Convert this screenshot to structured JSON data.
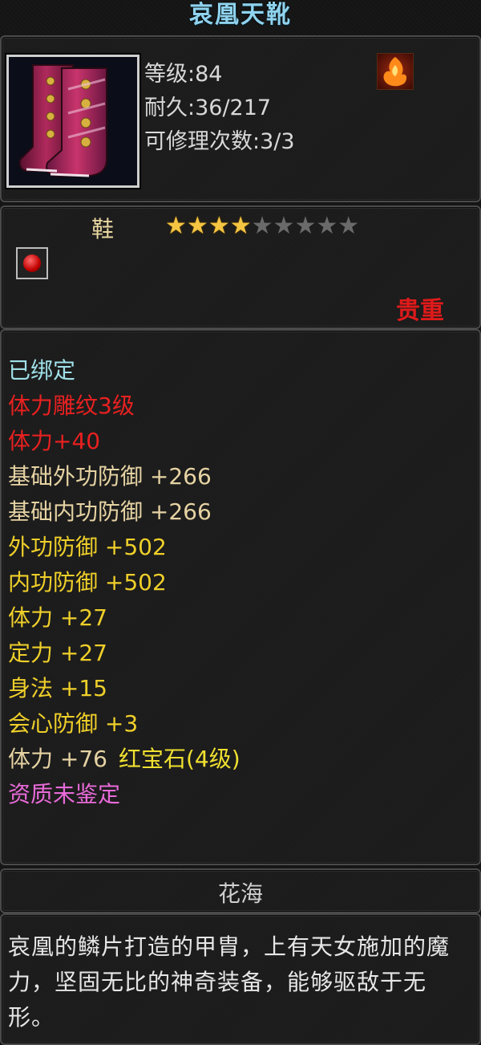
{
  "item": {
    "name": "哀凰天靴",
    "level": "等级:84",
    "durability": "耐久:36/217",
    "repair_count": "可修理次数:3/3",
    "icon": "purple-boots-icon",
    "school_icon": "flame-school-icon"
  },
  "type_section": {
    "item_type": "鞋",
    "stars_filled": 4,
    "stars_total": 9,
    "slot_icon": "red-gem-slot-icon",
    "rarity": "贵重",
    "rarity_color": "#e01a1a"
  },
  "attributes": {
    "bound": "已绑定",
    "engraving": "体力雕纹3级",
    "engraving_bonus": "体力+40",
    "base_outer_def": "基础外功防御 +266",
    "base_inner_def": "基础内功防御 +266",
    "outer_def": "外功防御 +502",
    "inner_def": "内功防御 +502",
    "stamina": "体力 +27",
    "focus": "定力 +27",
    "agility": "身法 +15",
    "crit_def": "会心防御 +3",
    "gem_bonus": "体力 +76",
    "gem_name": "红宝石(4级)",
    "aptitude": "资质未鉴定"
  },
  "set": {
    "name": "花海"
  },
  "description": {
    "text": "哀凰的鳞片打造的甲胄，上有天女施加的魔力，坚固无比的神奇装备，能够驱敌于无形。"
  }
}
